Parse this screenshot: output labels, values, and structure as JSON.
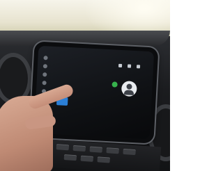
{
  "scene": {
    "description_icons": [
      "phone-keypad",
      "call-icon",
      "contact-avatar-icon"
    ]
  },
  "display": {
    "keypad_keys": [
      "",
      "",
      "",
      "",
      "",
      "",
      "",
      "",
      "",
      "",
      "",
      ""
    ],
    "details_label": ""
  },
  "colors": {
    "active_key": "#2b7fd6",
    "call_icon": "#37b24d",
    "skin": "#c48d78",
    "dashboard": "#1b1c1f"
  }
}
